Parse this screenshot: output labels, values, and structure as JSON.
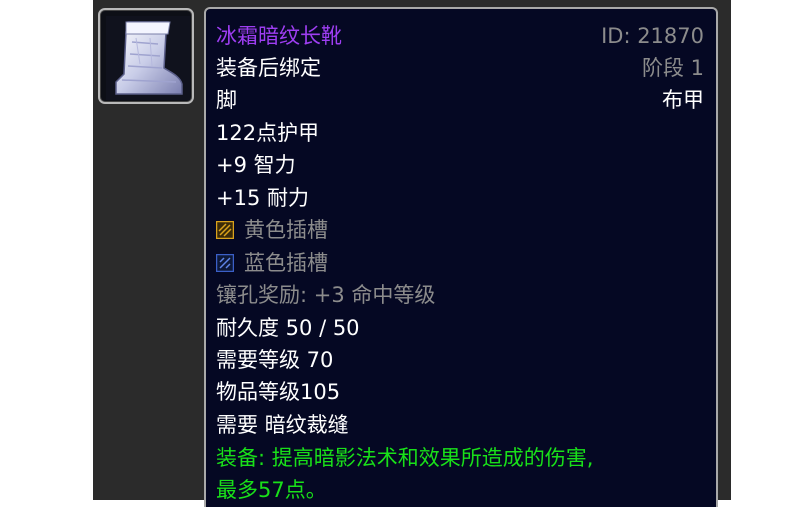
{
  "item": {
    "name": "冰霜暗纹长靴",
    "id": "ID: 21870",
    "phase": "阶段 1",
    "binding": "装备后绑定",
    "slot": "脚",
    "armor_type": "布甲",
    "armor": "122点护甲",
    "stats": [
      "+9 智力",
      "+15 耐力"
    ],
    "sockets": [
      {
        "label": "黄色插槽",
        "icon": "yellow-socket-icon",
        "color": "#d9a21c"
      },
      {
        "label": "蓝色插槽",
        "icon": "blue-socket-icon",
        "color": "#3b5fc7"
      }
    ],
    "socket_bonus": "镶孔奖励: +3 命中等级",
    "durability": "耐久度 50 / 50",
    "required_level": "需要等级 70",
    "item_level": "物品等级105",
    "required_skill": "需要 暗纹裁缝",
    "equip_effect_line1": "装备:  提高暗影法术和效果所造成的伤害,",
    "equip_effect_line2": "最多57点。",
    "icon": "boots-icon"
  },
  "colors": {
    "name": "#9e3ef2",
    "secondary": "#8c8c8c",
    "effect": "#19e019",
    "tooltip_bg": "#050823"
  }
}
